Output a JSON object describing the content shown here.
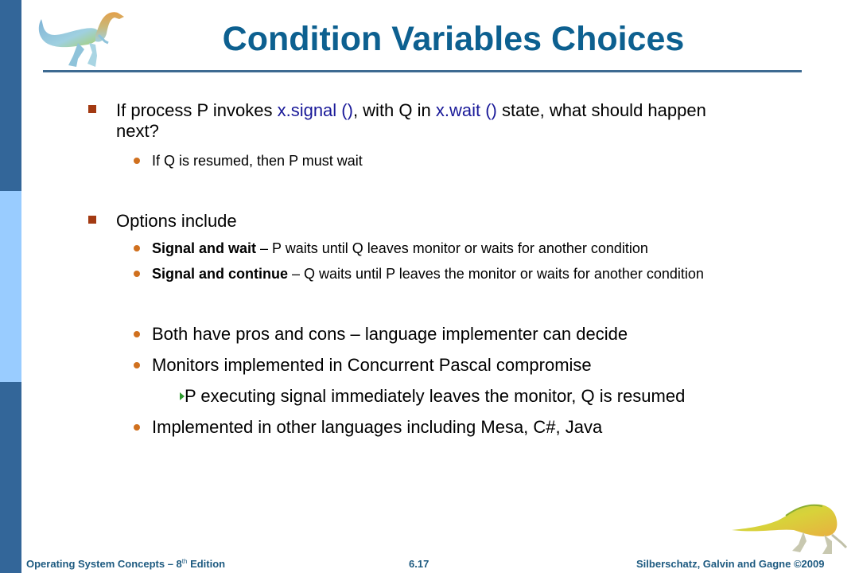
{
  "slide": {
    "title": "Condition Variables Choices",
    "bullets": [
      {
        "level": 1,
        "text_before": "If process P invokes ",
        "code1": "x.signal ()",
        "text_mid": ", with Q in ",
        "code2": "x.wait ()",
        "text_after": " state, what should happen",
        "text_wrap": "next?"
      },
      {
        "level": 2,
        "text": "If Q is resumed, then P must wait"
      },
      {
        "level": 1,
        "text": "Options include"
      },
      {
        "level": 2,
        "bold": "Signal and wait",
        "text": " – P waits until Q leaves monitor or waits for another condition"
      },
      {
        "level": 2,
        "bold": "Signal and continue",
        "text": " – Q waits until P leaves the monitor or waits for another condition"
      },
      {
        "level": 2,
        "text": "Both have pros and cons – language implementer can decide"
      },
      {
        "level": 2,
        "text": "Monitors implemented in Concurrent Pascal compromise"
      },
      {
        "level": 3,
        "text": "P executing signal immediately leaves the monitor, Q is resumed"
      },
      {
        "level": 2,
        "text": "Implemented in other languages including Mesa, C#, Java"
      }
    ]
  },
  "footer": {
    "book_title": "Operating System Concepts – 8",
    "book_sup": "th",
    "book_edition": " Edition",
    "page_number": "6.17",
    "copyright": "Silberschatz, Galvin and Gagne ©2009"
  },
  "colors": {
    "title": "#0D6090",
    "sidebar_dark": "#336699",
    "sidebar_light": "#99CCFF",
    "square_bullet": "#A33A12",
    "round_bullet": "#D0701E",
    "triangle_bullet": "#2E9A2E",
    "code_text": "#1A1A99",
    "footer_text": "#1D5A80"
  },
  "icons": {
    "top_left": "dinosaur-icon",
    "bottom_right": "dinosaur-icon"
  }
}
